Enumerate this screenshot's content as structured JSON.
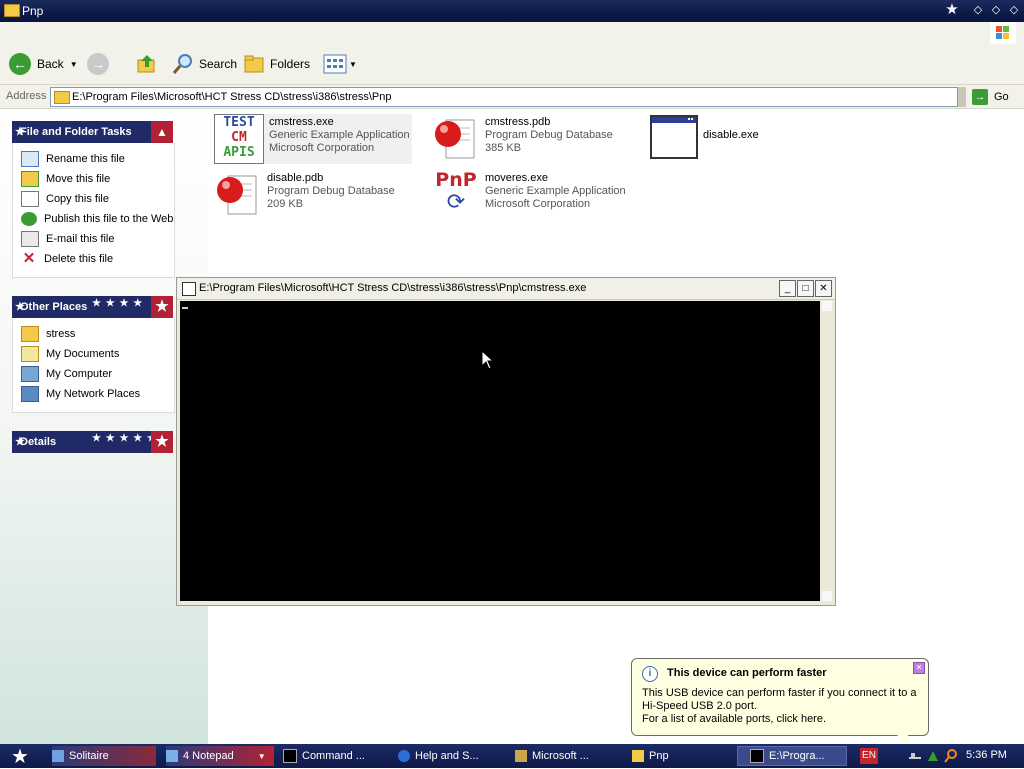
{
  "window": {
    "title": "Pnp"
  },
  "toolbar": {
    "back": "Back",
    "search": "Search",
    "folders": "Folders"
  },
  "address": {
    "label": "Address",
    "path": "E:\\Program Files\\Microsoft\\HCT Stress CD\\stress\\i386\\stress\\Pnp",
    "go": "Go"
  },
  "tasks_panel": {
    "title": "File and Folder Tasks",
    "items": [
      "Rename this file",
      "Move this file",
      "Copy this file",
      "Publish this file to the Web",
      "E-mail this file",
      "Delete this file"
    ]
  },
  "places_panel": {
    "title": "Other Places",
    "items": [
      "stress",
      "My Documents",
      "My Computer",
      "My Network Places"
    ]
  },
  "details_panel": {
    "title": "Details"
  },
  "files": [
    {
      "name": "cmstress.exe",
      "line2": "Generic Example Application",
      "line3": "Microsoft Corporation",
      "icon_text": [
        "TEST",
        "CM",
        "APIS"
      ]
    },
    {
      "name": "cmstress.pdb",
      "line2": "Program Debug Database",
      "line3": "385 KB"
    },
    {
      "name": "disable.exe",
      "line2": "",
      "line3": ""
    },
    {
      "name": "disable.pdb",
      "line2": "Program Debug Database",
      "line3": "209 KB"
    },
    {
      "name": "moveres.exe",
      "line2": "Generic Example Application",
      "line3": "Microsoft Corporation",
      "icon_text": [
        "PnP"
      ]
    }
  ],
  "console": {
    "title": "E:\\Program Files\\Microsoft\\HCT Stress CD\\stress\\i386\\stress\\Pnp\\cmstress.exe"
  },
  "balloon": {
    "title": "This device can perform faster",
    "line1": "This USB device can perform faster if you connect it to a",
    "line2": "Hi-Speed USB 2.0 port.",
    "line3": "For a list of available ports, click here."
  },
  "taskbar": {
    "tasks": [
      "Solitaire",
      "4 Notepad",
      "Command ...",
      "Help and S...",
      "Microsoft ...",
      "Pnp",
      "E:\\Progra..."
    ],
    "language": "EN",
    "clock": "5:36 PM"
  },
  "colors": {
    "titlebar": "#0d1a48",
    "panel_header": "#1f2a66",
    "panel_accent": "#b22234",
    "balloon_bg": "#ffffe1"
  }
}
